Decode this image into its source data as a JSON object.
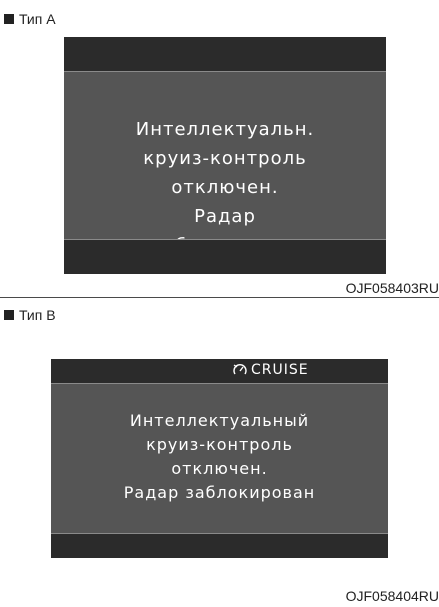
{
  "section_a": {
    "label": "Тип А",
    "message_lines": [
      "Интеллектуальн.",
      "круиз-контроль",
      "отключен.",
      "Радар",
      "заблокирован"
    ],
    "code": "OJF058403RU"
  },
  "section_b": {
    "label": "Тип В",
    "indicator": {
      "icon": "cruise-speedometer-icon",
      "label": "CRUISE"
    },
    "message_lines": [
      "Интеллектуальный",
      "круиз-контроль",
      "отключен.",
      "Радар заблокирован"
    ],
    "code": "OJF058404RU"
  }
}
